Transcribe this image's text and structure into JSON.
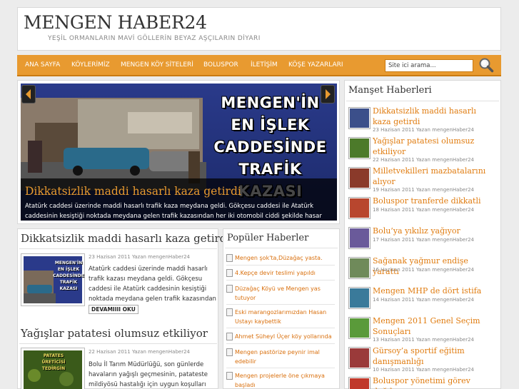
{
  "site": {
    "title": "MENGEN HABER24",
    "tagline": "YEŞİL ORMANLARIN MAVİ GÖLLERİN BEYAZ AŞÇILARIN DİYARI"
  },
  "nav": {
    "items": [
      "ANA SAYFA",
      "KÖYLERİMİZ",
      "MENGEN KÖY SİTELERİ",
      "BOLUSPOR",
      "İLETİŞİM",
      "KÖŞE YAZARLARI"
    ],
    "search_placeholder": "Site ici arama..."
  },
  "slider": {
    "image_text": [
      "MENGEN'İN",
      "EN İŞLEK",
      "CADDESİNDE",
      "TRAFİK KAZASI"
    ],
    "title": "Dikkatsizlik maddi hasarlı kaza getirdi",
    "text": "Atatürk caddesi üzerinde maddi hasarlı trafik kaza meydana geldi. Gökçesu caddesi ile Atatürk caddesinin kesiştiği noktada meydana gelen trafik kazasından her iki otomobil ciddi şekilde hasar gördü."
  },
  "articles": [
    {
      "title": "Dikkatsizlik maddi hasarlı kaza getirdi",
      "meta": "23 Hazisan 2011 Yazan mengenHaber24",
      "thumb_text": [
        "MENGEN'İN",
        "EN İŞLEK",
        "CADDESİNDE",
        "TRAFİK KAZASI"
      ],
      "excerpt": "Atatürk caddesi üzerinde maddi hasarlı trafik kazası meydana geldi. Gökçesu caddesi ile Atatürk caddesinin kesiştiği noktada meydana gelen trafik kazasından her iki ...",
      "more": "DEVAMIIII OKU"
    },
    {
      "title": "Yağışlar patatesi olumsuz etkiliyor",
      "meta": "22 Hazisan 2011 Yazan mengenHaber24",
      "thumb_text": [
        "PATATES",
        "ÜRETİCİSİ",
        "TEDİRGİN"
      ],
      "excerpt": "Bolu İl Tarım Müdürlüğü, son günlerde havaların yağışlı geçmesinin, patateste mildiyösü hastalığı için uygun koşulları"
    }
  ],
  "popular": {
    "heading": "Popüler Haberler",
    "items": [
      "Mengen şok'ta,Düzağaç yasta.",
      "4.Kepçe devir teslimi yapıldı",
      "Düzağaç Köyü ve Mengen yas tutuyor",
      "Eski marangozlarımızdan Hasan Ustayı kaybettik",
      "Ahmet Süheyl Üçer köy yollarında",
      "Mengen pastörize peynir imal edebilir",
      "Mengen projelerle öne çıkmaya başladı"
    ]
  },
  "manset": {
    "heading": "Manşet Haberleri",
    "items": [
      {
        "title": "Dikkatsizlik maddi hasarlı kaza getirdi",
        "meta": "23 Hazisan 2011 Yazan mengenHaber24",
        "color": "#3b4f8a"
      },
      {
        "title": "Yağışlar patatesi olumsuz etkiliyor",
        "meta": "22 Hazisan 2011 Yazan mengenHaber24",
        "color": "#4c7a2a"
      },
      {
        "title": "Milletvekilleri mazbatalarını alıyor",
        "meta": "19 Hazisan 2011 Yazan mengenHaber24",
        "color": "#8a3a2a"
      },
      {
        "title": "Boluspor tranferde dikkatli",
        "meta": "18 Hazisan 2011 Yazan mengenHaber24",
        "color": "#b8462e"
      },
      {
        "title": "Bolu’ya yıkılız yağıyor",
        "meta": "17 Hazisan 2011 Yazan mengenHaber24",
        "color": "#6a5a9a"
      },
      {
        "title": "Sağanak yağmur endişe yarattı",
        "meta": "16 Hazisan 2011 Yazan mengenHaber24",
        "color": "#6f8a5a"
      },
      {
        "title": "Mengen MHP de dört istifa",
        "meta": "14 Hazisan 2011 Yazan mengenHaber24",
        "color": "#3a7a9a"
      },
      {
        "title": "Mengen 2011 Genel Seçim Sonuçları",
        "meta": "13 Hazisan 2011 Yazan mengenHaber24",
        "color": "#5a9a3a"
      },
      {
        "title": "Gürsoy’a sportif eğitim danışmanlığı",
        "meta": "10 Hazisan 2011 Yazan mengenHaber24",
        "color": "#9a3a3a"
      },
      {
        "title": "Boluspor yönetimi görev dağılımı",
        "meta": "",
        "color": "#c0392b"
      }
    ]
  }
}
